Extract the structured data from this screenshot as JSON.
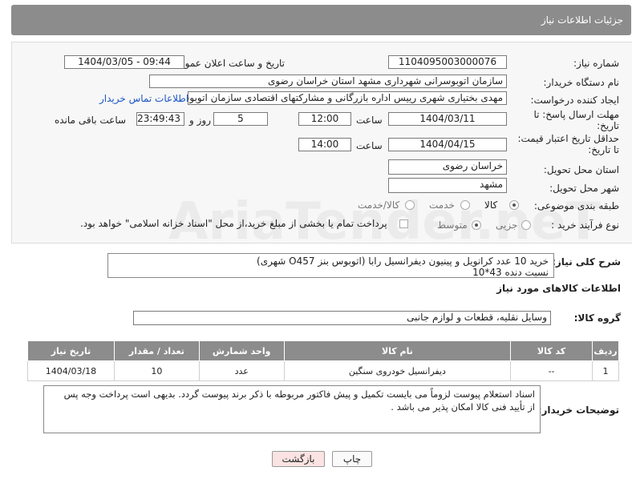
{
  "header": {
    "title": "جزئیات اطلاعات نیاز"
  },
  "form": {
    "need_number_label": "شماره نیاز:",
    "need_number": "1104095003000076",
    "announce_label": "تاریخ و ساعت اعلان عمومی:",
    "announce_value": "1404/03/05 - 09:44",
    "buyer_org_label": "نام دستگاه خریدار:",
    "buyer_org": "سازمان اتوبوسرانی شهرداری مشهد استان خراسان رضوی",
    "requester_label": "ایجاد کننده درخواست:",
    "requester": "مهدی بختیاری شهری رییس اداره بازرگانی و مشارکتهای اقتصادی سازمان اتوبوس",
    "contact_link": "اطلاعات تماس خریدار",
    "deadline_label": "مهلت ارسال پاسخ: تا تاریخ:",
    "deadline_date": "1404/03/11",
    "time_label": "ساعت",
    "deadline_time": "12:00",
    "days": "5",
    "days_label": "روز و",
    "remaining": "23:49:43",
    "remaining_label": "ساعت باقی مانده",
    "validity_label": "حداقل تاریخ اعتبار قیمت: تا تاریخ:",
    "validity_date": "1404/04/15",
    "validity_time": "14:00",
    "province_label": "استان محل تحویل:",
    "province": "خراسان رضوی",
    "city_label": "شهر محل تحویل:",
    "city": "مشهد",
    "category_label": "طبقه بندی موضوعی:",
    "category_options": [
      "کالا",
      "خدمت",
      "کالا/خدمت"
    ],
    "purchase_type_label": "نوع فرآیند خرید :",
    "purchase_options": [
      "جزیی",
      "متوسط"
    ],
    "payment_note": "پرداخت تمام یا بخشی از مبلغ خرید،از محل \"اسناد خزانه اسلامی\" خواهد بود."
  },
  "summary": {
    "label": "شرح کلی نیاز:",
    "line1": "خرید 10 عدد کرانویل و پینیون دیفرانسیل رابا (اتوبوس بنز O457 شهری)",
    "line2": "نسبت دنده 43*10"
  },
  "goods_section": {
    "title": "اطلاعات کالاهای مورد نیاز",
    "group_label": "گروه کالا:",
    "group_value": "وسایل نقلیه، قطعات و لوازم جانبی"
  },
  "table": {
    "headers": [
      "ردیف",
      "کد کالا",
      "نام کالا",
      "واحد شمارش",
      "تعداد / مقدار",
      "تاریخ نیاز"
    ],
    "rows": [
      [
        "1",
        "--",
        "دیفرانسیل خودروی سنگین",
        "عدد",
        "10",
        "1404/03/18"
      ]
    ]
  },
  "buyer_notes": {
    "label": "توضیحات خریدار:",
    "line1": "اسناد استعلام پیوست لزوماً می بایست تکمیل و پیش فاکتور مربوطه با ذکر برند پیوست گردد. بدیهی است پرداخت وجه پس",
    "line2": "از تأیید فنی کالا امکان پذیر می باشد ."
  },
  "buttons": {
    "print": "چاپ",
    "back": "بازگشت"
  },
  "watermark": "AriaTender.neT",
  "colors": {
    "header_bg": "#8c8c8c",
    "link": "#1a55c4",
    "back_button_bg": "#fbe3e3"
  }
}
